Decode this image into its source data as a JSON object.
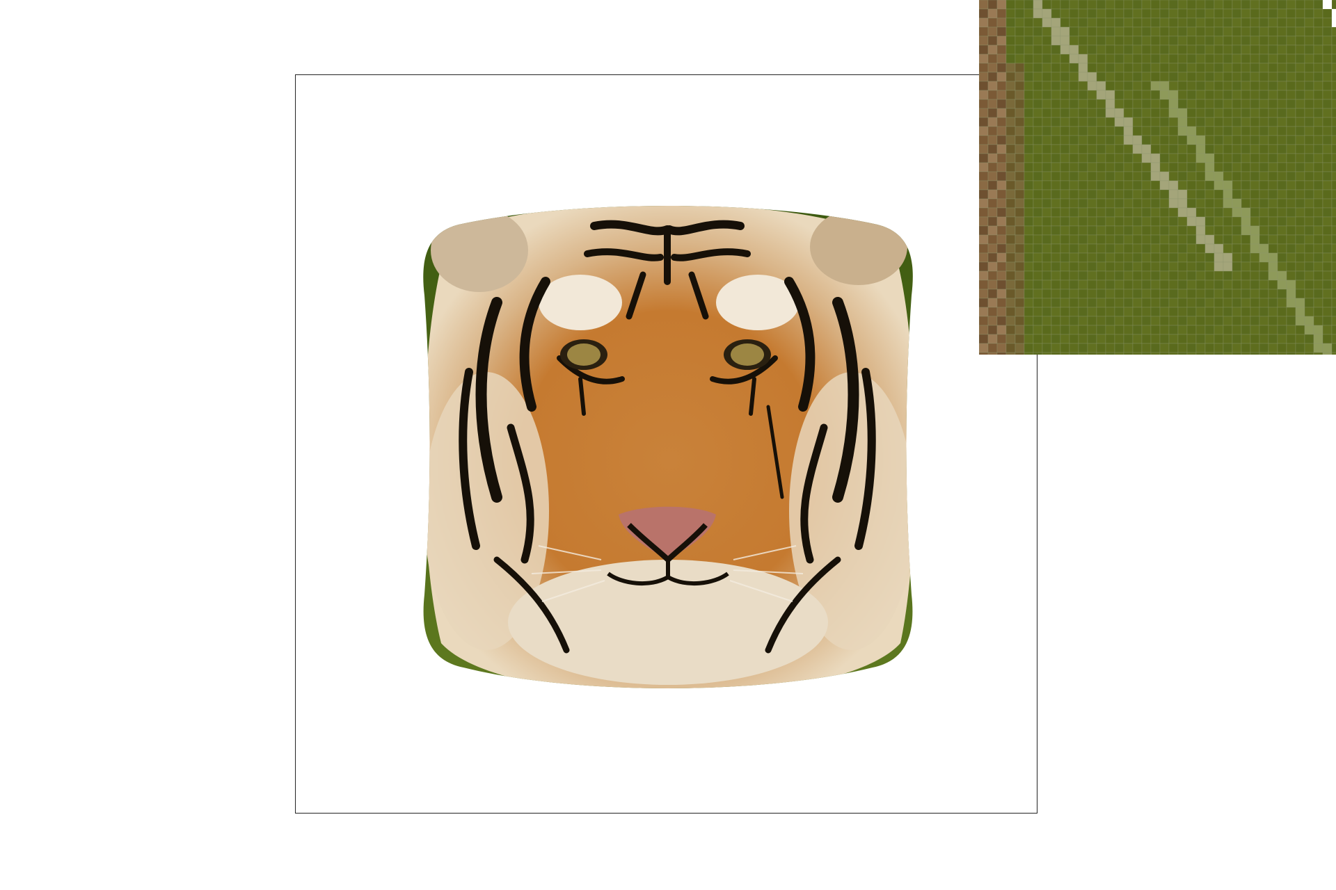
{
  "view": {
    "canvas_icon": "warped-tiger-image",
    "magnifier_icon": "pixel-magnifier",
    "colors": {
      "background": "#ffffff",
      "frame_border": "#222222",
      "grass": "#5e6d1e",
      "fur_orange": "#c9823a",
      "fur_light": "#ead9bd",
      "stripe": "#161008",
      "nose": "#b9736a"
    }
  }
}
